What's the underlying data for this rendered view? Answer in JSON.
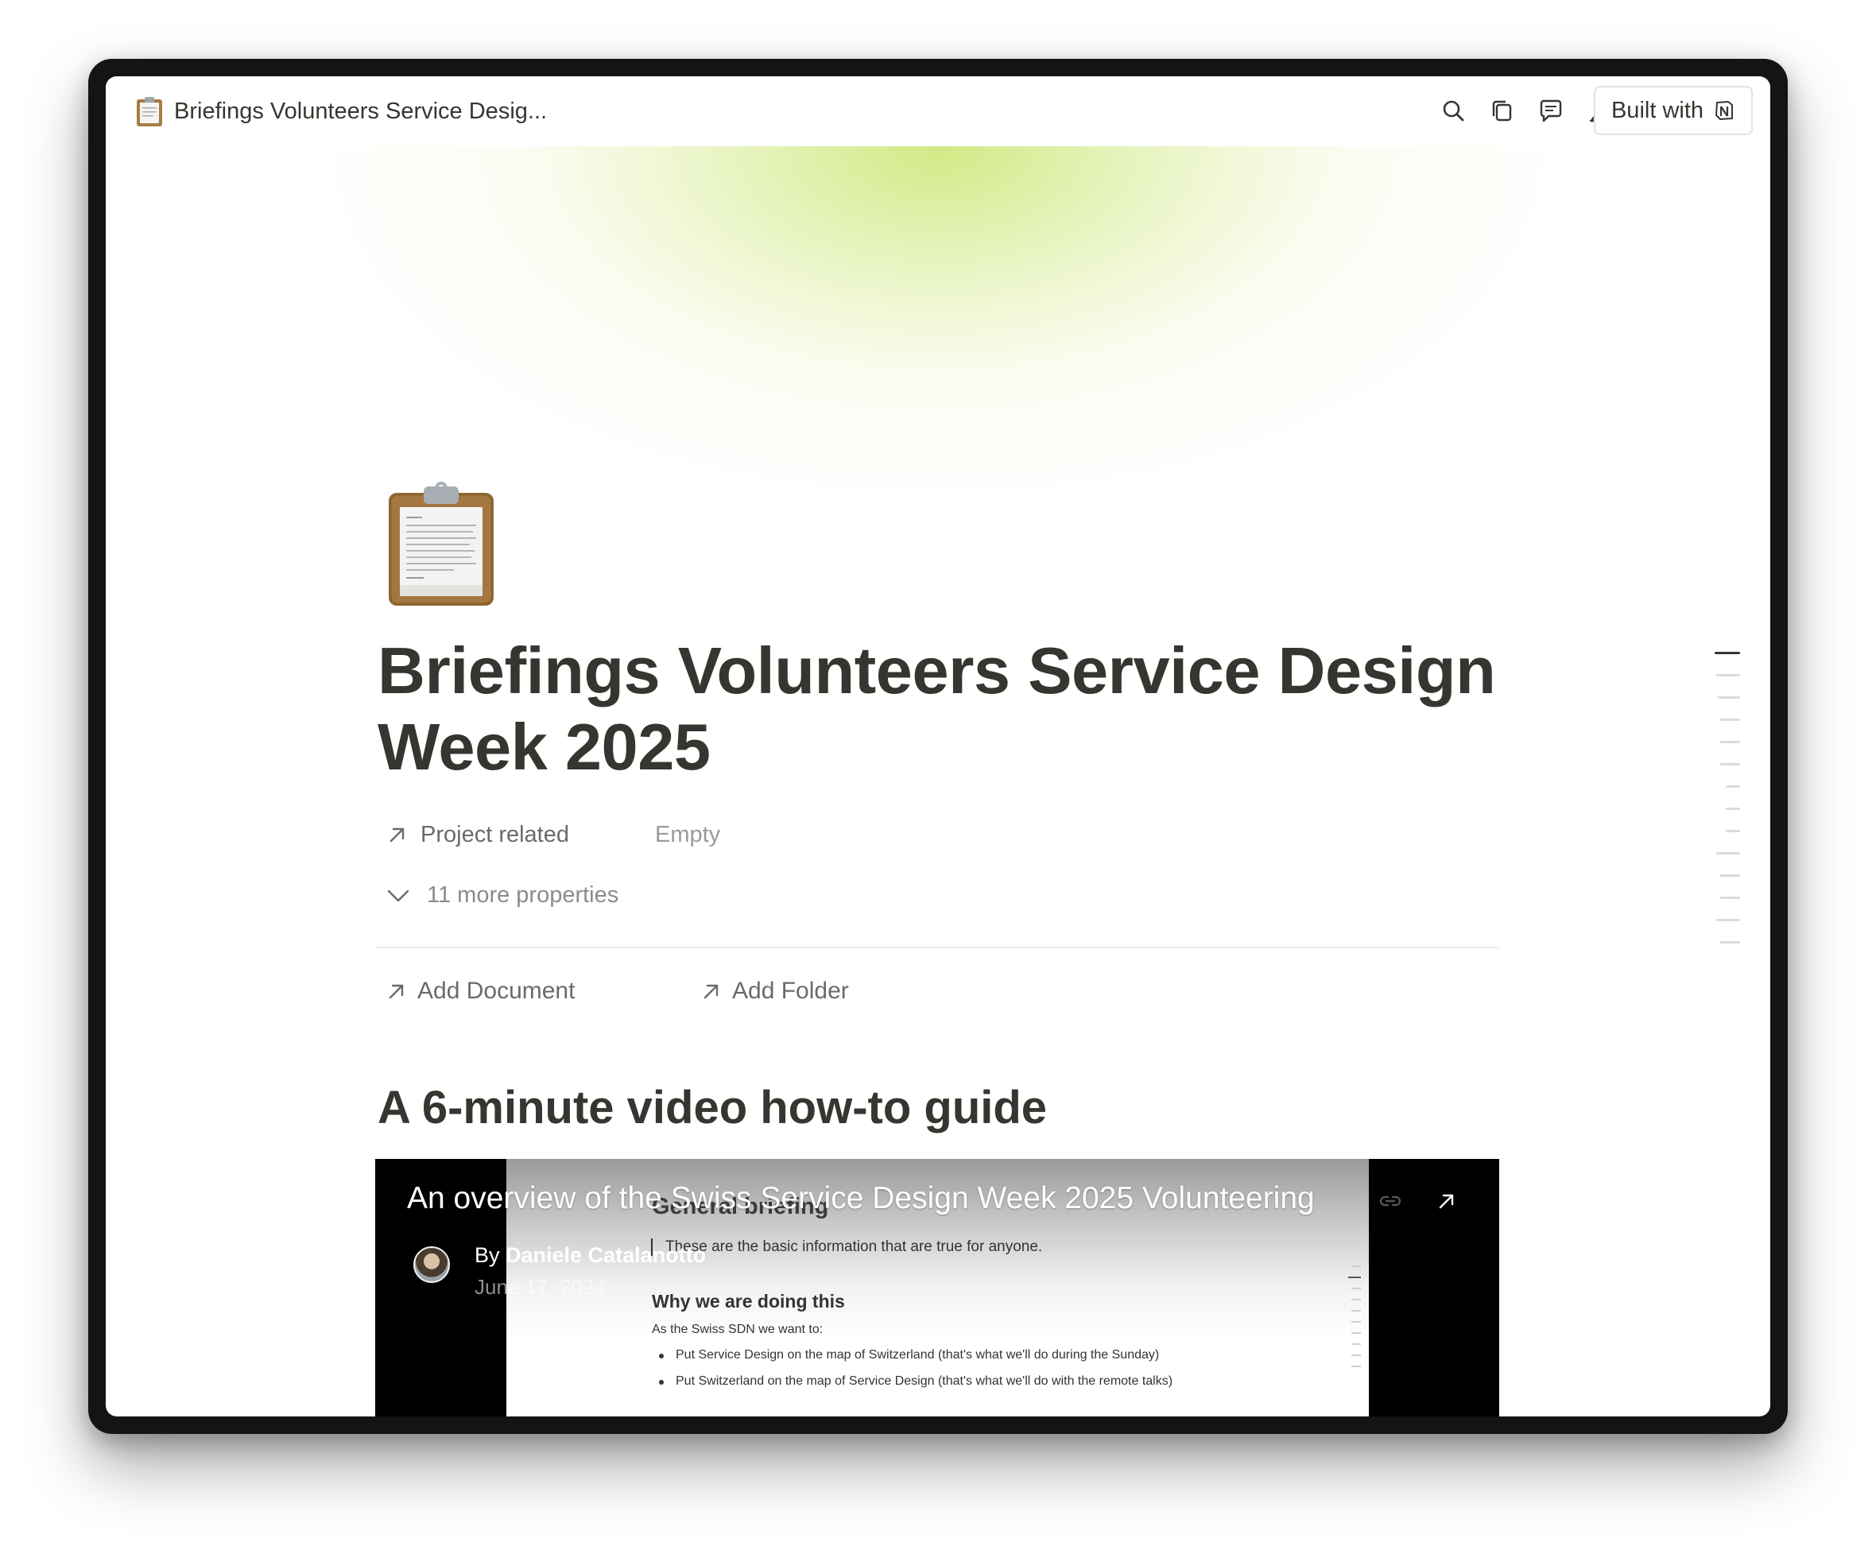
{
  "topbar": {
    "breadcrumb_title": "Briefings Volunteers Service Desig...",
    "built_with_label": "Built with",
    "icons": [
      "search-icon",
      "duplicate-icon",
      "comment-icon",
      "edit-icon",
      "more-icon",
      "notion-logo-icon"
    ]
  },
  "page": {
    "icon": "clipboard-icon",
    "title": "Briefings Volunteers Service Design Week 2025",
    "properties": {
      "project_related_label": "Project related",
      "project_related_value": "Empty",
      "more_properties_label": "11 more properties"
    },
    "links": {
      "add_document": "Add Document",
      "add_folder": "Add Folder"
    },
    "section_heading": "A 6-minute video how-to guide"
  },
  "video": {
    "title": "An overview of the Swiss Service Design Week 2025 Volunteering",
    "by_label": "By",
    "author": "Daniele Catalanotto",
    "date": "June 17, 2024",
    "content": {
      "heading": "General briefing",
      "intro": "These are the basic information that are true for anyone.",
      "subheading": "Why we are doing this",
      "lead": "As the Swiss SDN we want to:",
      "bullets": [
        "Put Service Design on the map of Switzerland (that's what we'll do during the Sunday)",
        "Put Switzerland on the map of Service Design (that's what we'll do with the remote talks)"
      ]
    }
  },
  "colors": {
    "text": "#37352f",
    "muted": "#6b6a66",
    "cover_accent": "#cee678",
    "video_bg": "#000000"
  }
}
